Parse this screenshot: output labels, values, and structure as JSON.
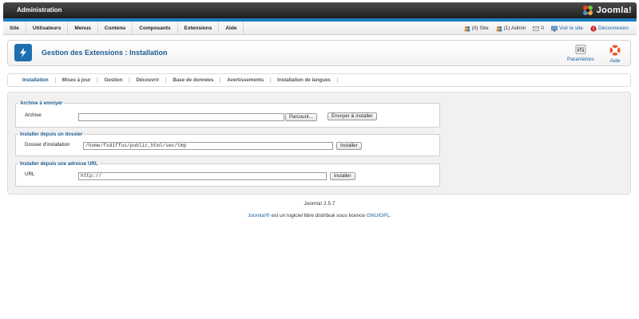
{
  "topbar": {
    "title": "Administration",
    "logo_text": "Joomla!"
  },
  "menu": {
    "items": [
      "Site",
      "Utilisateurs",
      "Menus",
      "Contenu",
      "Composants",
      "Extensions",
      "Aide"
    ]
  },
  "status": {
    "site_visitors": "(0) Site",
    "admin_users": "(1) Admin",
    "messages": "0",
    "view_site": "Voir le site",
    "logout": "Déconnexion"
  },
  "toolbar": {
    "page_title": "Gestion des Extensions : Installation",
    "params_label": "Paramètres",
    "help_label": "Aide"
  },
  "tabs": [
    "Installation",
    "Mises à jour",
    "Gestion",
    "Découvrir",
    "Base de données",
    "Avertissements",
    "Installation de langues"
  ],
  "upload": {
    "legend": "Archive à envoyer",
    "label": "Archive",
    "value": "",
    "browse_label": "Parcourir...",
    "submit_label": "Envoyer & installer"
  },
  "folder": {
    "legend": "Installer depuis un dossier",
    "label": "Dossier d'installation",
    "value": "/home/fsdiffus/public_html/sec/tmp",
    "submit_label": "Installer"
  },
  "url": {
    "legend": "Installer depuis une adresse URL",
    "label": "URL",
    "value": "http://",
    "submit_label": "Installer"
  },
  "footer": {
    "version": "Joomla! 2.5.7",
    "license_link": "Joomla!®",
    "license_text": " est un logiciel libre distribué sous licence ",
    "license_name": "GNU/GPL",
    "license_end": "."
  },
  "colors": {
    "accent": "#1b7ec1",
    "title_blue": "#1b5c93",
    "link_blue": "#1a5fa8",
    "logout_red": "#cc2222"
  }
}
